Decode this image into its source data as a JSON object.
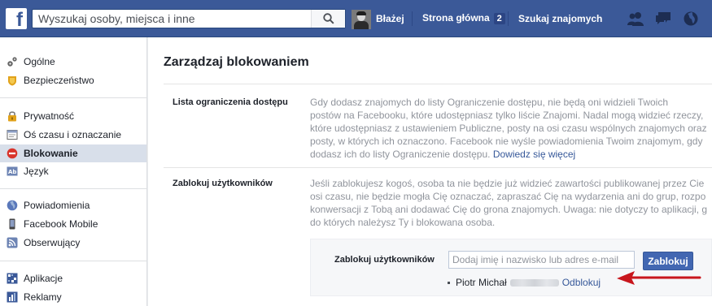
{
  "topbar": {
    "logo": "f",
    "search_placeholder": "Wyszukaj osoby, miejsca i inne",
    "user_name": "Błażej",
    "home_label": "Strona główna",
    "home_badge": "2",
    "find_friends_label": "Szukaj znajomych"
  },
  "sidebar": {
    "items": [
      {
        "label": "Ogólne",
        "icon": "gears-icon"
      },
      {
        "label": "Bezpieczeństwo",
        "icon": "badge-icon"
      },
      {
        "label": "Prywatność",
        "icon": "lock-icon"
      },
      {
        "label": "Oś czasu i oznaczanie",
        "icon": "timeline-icon"
      },
      {
        "label": "Blokowanie",
        "icon": "block-icon"
      },
      {
        "label": "Język",
        "icon": "language-icon"
      },
      {
        "label": "Powiadomienia",
        "icon": "globe-icon"
      },
      {
        "label": "Facebook Mobile",
        "icon": "mobile-icon"
      },
      {
        "label": "Obserwujący",
        "icon": "rss-icon"
      },
      {
        "label": "Aplikacje",
        "icon": "apps-icon"
      },
      {
        "label": "Reklamy",
        "icon": "ads-icon"
      }
    ]
  },
  "main": {
    "title": "Zarządzaj blokowaniem",
    "restricted": {
      "label": "Lista ograniczenia dostępu",
      "lines": [
        "Gdy dodasz znajomych do listy Ograniczenie dostępu, nie będą oni widzieli Twoich",
        "postów na Facebooku, które udostępniasz tylko liście Znajomi. Nadal mogą widzieć rzeczy,",
        "które udostępniasz z ustawieniem Publiczne, posty na osi czasu wspólnych znajomych oraz",
        "posty, w których ich oznaczono. Facebook nie wyśle powiadomienia Twoim znajomym, gdy",
        "dodasz ich do listy Ograniczenie dostępu."
      ],
      "link": "Dowiedz się więcej"
    },
    "block_users": {
      "label": "Zablokuj użytkowników",
      "lines": [
        "Jeśli zablokujesz kogoś, osoba ta nie będzie już widzieć zawartości publikowanej przez Cie",
        "osi czasu, nie będzie mogła Cię oznaczać, zapraszać Cię na wydarzenia ani do grup, rozpo",
        "konwersacji z Tobą ani dodawać Cię do grona znajomych. Uwaga: nie dotyczy to aplikacji, g",
        "do których należysz Ty i blokowana osoba."
      ],
      "form_label": "Zablokuj użytkowników",
      "input_placeholder": "Dodaj imię i nazwisko lub adres e-mail",
      "button_label": "Zablokuj",
      "blocked_name": "Piotr Michał",
      "unblock_label": "Odblokuj"
    }
  },
  "colors": {
    "brand": "#3b5998",
    "link": "#365899",
    "button": "#4267b2",
    "arrow": "#c8161d",
    "active_item": "#d8dfea"
  }
}
